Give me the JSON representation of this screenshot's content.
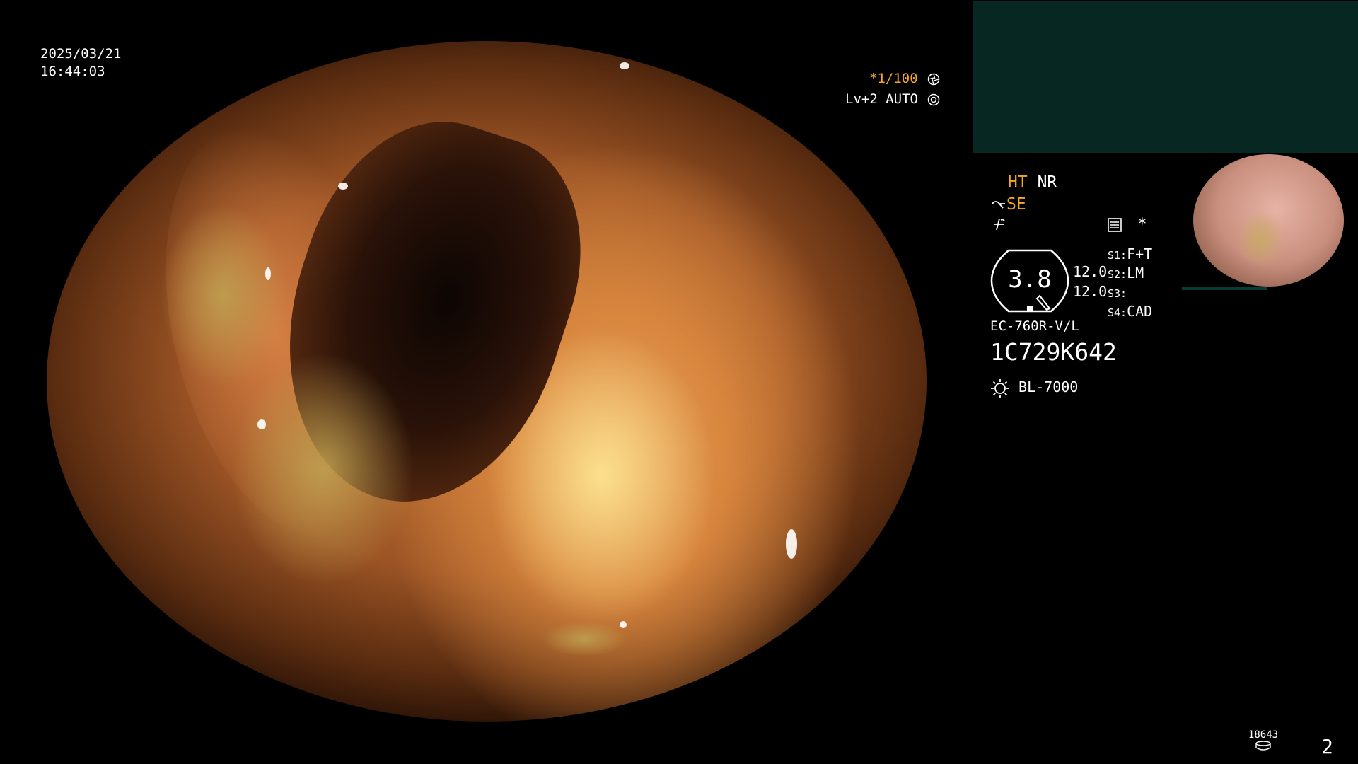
{
  "timestamp": {
    "date": "2025/03/21",
    "time": "16:44:03"
  },
  "overlay": {
    "shutter": "*1/100",
    "shutter_icon": "aperture-icon",
    "level": "Lv+2 AUTO",
    "level_icon": "auto-iris-icon"
  },
  "modes": {
    "ht": "HT",
    "nr": "NR",
    "se": "SE",
    "se_icon": "structure-enhance-icon",
    "edge_icon": "edge-enhance-icon",
    "menu_icon": "menu-list-icon",
    "asterisk": "*"
  },
  "gauge": {
    "value": "3.8"
  },
  "values": [
    "12.0",
    "12.0"
  ],
  "settings": [
    {
      "key": "S1:",
      "value": "F+T"
    },
    {
      "key": "S2:",
      "value": "LM"
    },
    {
      "key": "S3:",
      "value": ""
    },
    {
      "key": "S4:",
      "value": "CAD"
    }
  ],
  "scope": {
    "model": "EC-760R-V/L",
    "serial": "1C729K642"
  },
  "light": {
    "icon": "light-source-icon",
    "label": "BL-7000"
  },
  "footer": {
    "counter": "18643",
    "counter_icon": "storage-icon",
    "page": "2"
  },
  "colors": {
    "accent": "#f5a623",
    "panel": "#062722",
    "text": "#ffffff"
  }
}
